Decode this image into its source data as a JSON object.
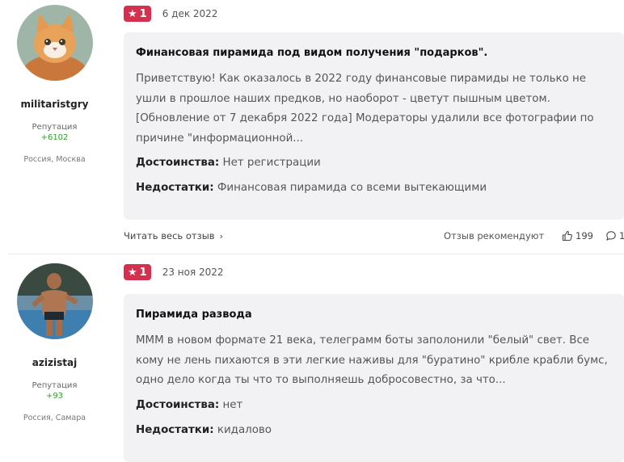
{
  "reviews": [
    {
      "username": "militaristgry",
      "reputation_label": "Репутация",
      "reputation_value": "+6102",
      "city": "Россия, Москва",
      "rating": "1",
      "date": "6 дек 2022",
      "title": "Финансовая пирамида под видом получения \"подарков\".",
      "text": "Приветствую! Как оказалось в 2022 году финансовые пирамиды не только не ушли в прошлое наших предков, но наоборот - цветут пышным цветом. [Обновление от 7 декабря 2022 года] Модераторы удалили все фотографии по причине \"информационной...",
      "pros_label": "Достоинства:",
      "pros": "Нет регистрации",
      "cons_label": "Недостатки:",
      "cons": "Финансовая пирамида со всеми вытекающими",
      "read_more": "Читать весь отзыв",
      "recommend": "Отзыв рекомендуют",
      "likes": "199",
      "comments": "1"
    },
    {
      "username": "azizistaj",
      "reputation_label": "Репутация",
      "reputation_value": "+93",
      "city": "Россия, Самара",
      "rating": "1",
      "date": "23 ноя 2022",
      "title": "Пирамида развода",
      "text": "МММ в новом формате 21 века, телеграмм боты заполонили \"белый\" свет. Все кому не лень пихаются в эти легкие наживы для \"буратино\" крибле крабли бумс, одно дело когда ты что то выполняешь добросовестно, за что...",
      "pros_label": "Достоинства:",
      "pros": "нет",
      "cons_label": "Недостатки:",
      "cons": "кидалово"
    }
  ],
  "colors": {
    "badge": "#d4304f",
    "reputation": "#33a02c",
    "card": "#f2f2f4"
  },
  "icons": [
    "star-icon",
    "chevron-right-icon",
    "thumbs-up-icon",
    "comment-icon"
  ]
}
